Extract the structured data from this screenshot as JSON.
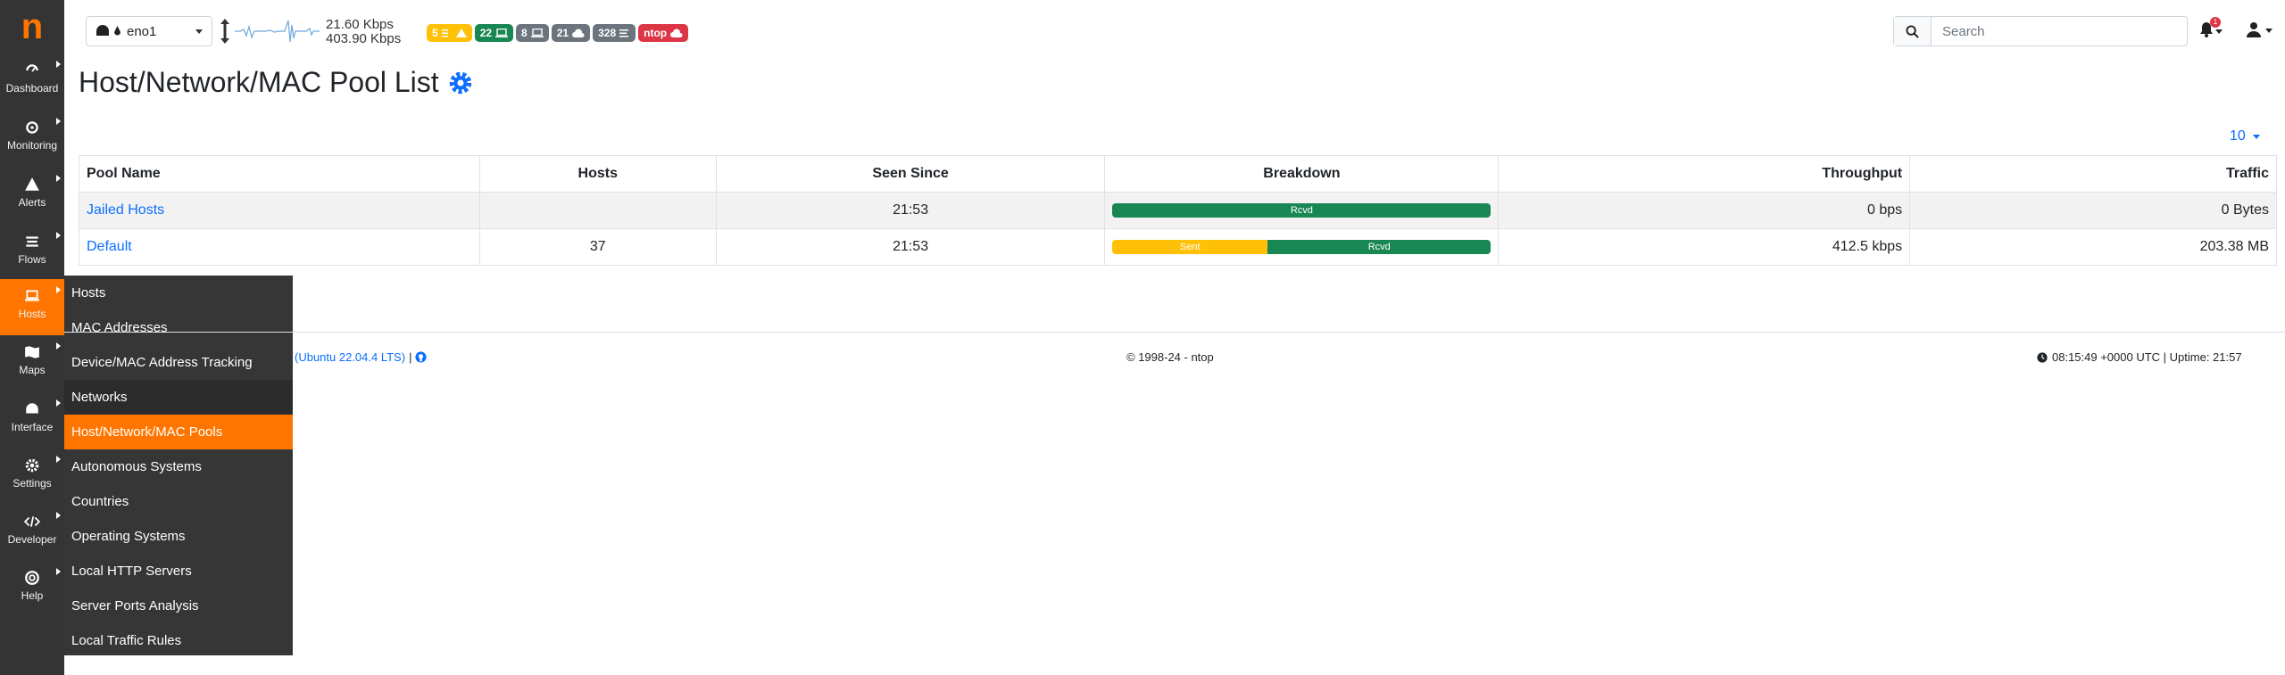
{
  "sidebar": {
    "logo": "n",
    "items": [
      {
        "label": "Dashboard",
        "icon": "gauge-icon"
      },
      {
        "label": "Monitoring",
        "icon": "radar-icon"
      },
      {
        "label": "Alerts",
        "icon": "warning-icon"
      },
      {
        "label": "Flows",
        "icon": "stream-icon"
      },
      {
        "label": "Hosts",
        "icon": "laptop-icon"
      },
      {
        "label": "Maps",
        "icon": "map-icon"
      },
      {
        "label": "Interface",
        "icon": "ethernet-icon"
      },
      {
        "label": "Settings",
        "icon": "gear-icon"
      },
      {
        "label": "Developer",
        "icon": "code-icon"
      },
      {
        "label": "Help",
        "icon": "lifebuoy-icon"
      }
    ]
  },
  "submenu": {
    "items": [
      "Hosts",
      "MAC Addresses",
      "Device/MAC Address Tracking",
      "Networks",
      "Host/Network/MAC Pools",
      "Autonomous Systems",
      "Countries",
      "Operating Systems",
      "Local HTTP Servers",
      "Server Ports Analysis",
      "Local Traffic Rules"
    ],
    "active": "Host/Network/MAC Pools"
  },
  "topbar": {
    "interface": "eno1",
    "upload_rate": "21.60 Kbps",
    "download_rate": "403.90 Kbps",
    "badges": [
      {
        "text": "5",
        "color": "#ffc107",
        "icon": "alert-triangle-icon"
      },
      {
        "text": "22",
        "color": "#198754",
        "icon": "laptop-icon"
      },
      {
        "text": "8",
        "color": "#6c757d",
        "icon": "laptop-icon"
      },
      {
        "text": "21",
        "color": "#6c757d",
        "icon": "cloud-icon"
      },
      {
        "text": "328",
        "color": "#6c757d",
        "icon": "list-icon"
      },
      {
        "text": "ntop",
        "color": "#dc3545",
        "icon": "cloud-icon"
      }
    ],
    "search_placeholder": "Search",
    "notifications_count": "1"
  },
  "page": {
    "title": "Host/Network/MAC Pool List",
    "page_size": "10"
  },
  "table": {
    "headers": [
      "Pool Name",
      "Hosts",
      "Seen Since",
      "Breakdown",
      "Throughput",
      "Traffic"
    ],
    "rows": [
      {
        "name": "Jailed Hosts",
        "hosts": "",
        "seen_since": "21:53",
        "sent_label": "",
        "rcvd_label": "Rcvd",
        "sent_fraction": 0,
        "throughput": "0 bps",
        "traffic": "0 Bytes"
      },
      {
        "name": "Default",
        "hosts": "37",
        "seen_since": "21:53",
        "sent_label": "Sent",
        "rcvd_label": "Rcvd",
        "sent_fraction": 0.41,
        "throughput": "412.5 kbps",
        "traffic": "203.38 MB"
      }
    ]
  },
  "footer": {
    "os": "(Ubuntu 22.04.4 LTS)",
    "separator": "|",
    "copyright": "© 1998-24 - ntop",
    "status": "08:15:49 +0000 UTC | Uptime: 21:57"
  },
  "colors": {
    "accent": "#ff7500",
    "sidebar": "#343434",
    "link": "#0d6efd",
    "success": "#198754",
    "warning": "#ffc107"
  }
}
